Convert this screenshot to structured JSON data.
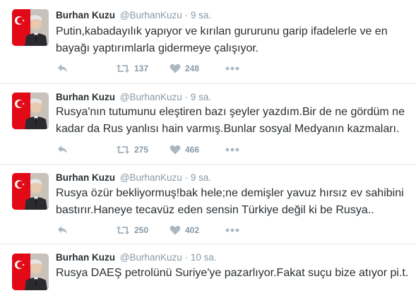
{
  "colors": {
    "text": "#292f33",
    "muted": "#8899a6",
    "icon": "#aab8c2",
    "divider": "#e1e8ed",
    "flag_red": "#e30a17"
  },
  "tweets": [
    {
      "name": "Burhan Kuzu",
      "handle": "@BurhanKuzu",
      "separator": "·",
      "time": "9 sa.",
      "text": "Putin,kabadayılık yapıyor ve kırılan gururunu garip ifadelerle ve en bayağı yaptırımlarla gidermeye çalışıyor.",
      "retweets": "137",
      "likes": "248"
    },
    {
      "name": "Burhan Kuzu",
      "handle": "@BurhanKuzu",
      "separator": "·",
      "time": "9 sa.",
      "text": "Rusya'nın tutumunu eleştiren bazı şeyler yazdım.Bir de ne gördüm ne kadar da Rus yanlısı hain  varmış.Bunlar sosyal Medyanın kazmaları.",
      "retweets": "275",
      "likes": "466"
    },
    {
      "name": "Burhan Kuzu",
      "handle": "@BurhanKuzu",
      "separator": "·",
      "time": "9 sa.",
      "text": "Rusya özür bekliyormuş!bak hele;ne demişler yavuz hırsız  ev sahibini bastırır.Haneye tecavüz eden sensin Türkiye değil ki be Rusya..",
      "retweets": "250",
      "likes": "402"
    },
    {
      "name": "Burhan Kuzu",
      "handle": "@BurhanKuzu",
      "separator": "·",
      "time": "10 sa.",
      "text": "Rusya DAEŞ petrolünü Suriye'ye pazarlıyor.Fakat suçu bize atıyor pi.t.",
      "retweets": "",
      "likes": ""
    }
  ],
  "icons": {
    "reply": "reply-icon",
    "retweet": "retweet-icon",
    "like": "heart-icon",
    "more": "more-dots-icon"
  }
}
